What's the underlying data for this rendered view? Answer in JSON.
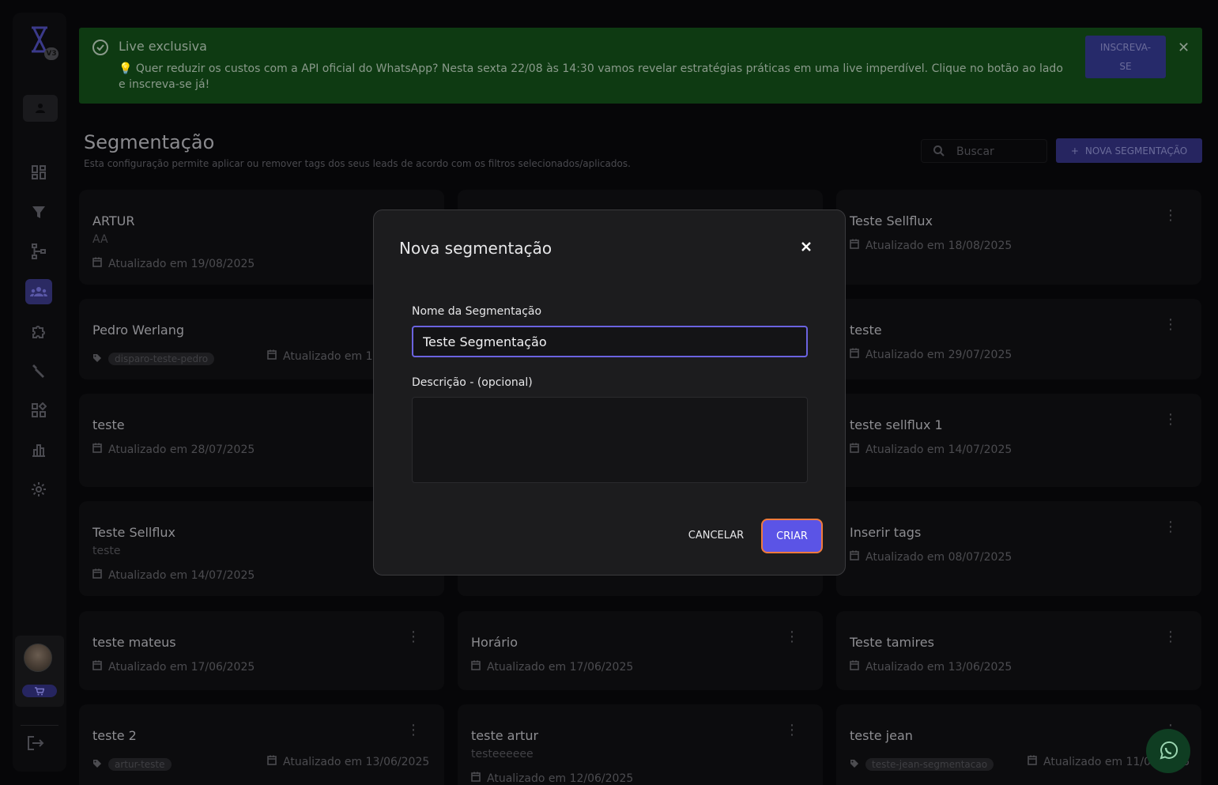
{
  "banner": {
    "title": "Live exclusiva",
    "message": "💡 Quer reduzir os custos com a API oficial do WhatsApp? Nesta sexta 22/08 às 14:30 vamos revelar estratégias práticas em uma live imperdível. Clique no botão ao lado e inscreva-se já!",
    "button_line1": "INSCREVA-",
    "button_line2": "SE",
    "close_label": "✕"
  },
  "sidebar": {
    "version_badge": "V3",
    "items": [
      "dashboard-icon",
      "funnel-icon",
      "flow-icon",
      "segment-icon",
      "integration-icon",
      "tools-icon",
      "apps-icon",
      "reports-icon",
      "settings-icon"
    ],
    "active_item": "segment-icon"
  },
  "page": {
    "title": "Segmentação",
    "subtitle": "Esta configuração permite aplicar ou remover tags dos seus leads de acordo com os filtros selecionados/aplicados.",
    "search_placeholder": "Buscar",
    "new_button": "NOVA SEGMENTAÇÃO"
  },
  "cards": [
    {
      "title": "ARTUR",
      "desc": "AA",
      "date": "Atualizado em 19/08/2025"
    },
    {
      "title": "Teste Sellflux",
      "date": "Atualizado em 18/08/2025"
    },
    {
      "title": "Pedro Werlang",
      "tag": "disparo-teste-pedro",
      "date": "Atualizado em 1"
    },
    {
      "title": "teste",
      "date": "Atualizado em 29/07/2025"
    },
    {
      "title": "teste",
      "date": "Atualizado em 28/07/2025"
    },
    {
      "title": "teste sellflux 1",
      "date": "Atualizado em 14/07/2025"
    },
    {
      "title": "Teste Sellflux",
      "desc": "teste",
      "date": "Atualizado em 14/07/2025"
    },
    {
      "title": "Inserir tags",
      "date": "Atualizado em 08/07/2025"
    },
    {
      "title": "teste mateus",
      "date": "Atualizado em 17/06/2025"
    },
    {
      "title": "Horário",
      "date": "Atualizado em 17/06/2025"
    },
    {
      "title": "Teste tamires",
      "date": "Atualizado em 13/06/2025"
    },
    {
      "title": "teste 2",
      "tag": "artur-teste",
      "date": "Atualizado em 13/06/2025"
    },
    {
      "title": "teste artur",
      "desc": "testeeeeee",
      "date": "Atualizado em 12/06/2025"
    },
    {
      "title": "teste jean",
      "tag": "teste-jean-segmentacao",
      "date": "Atualizado em 11/06/2025"
    }
  ],
  "modal": {
    "title": "Nova segmentação",
    "name_label": "Nome da Segmentação",
    "name_value": "Teste Segmentação",
    "desc_label": "Descrição - (opcional)",
    "desc_value": "",
    "cancel_label": "CANCELAR",
    "create_label": "CRIAR"
  },
  "colors": {
    "accent": "#5b54e6",
    "focus_ring": "#f07a3c",
    "banner_bg": "#0e3a12",
    "background": "#060608"
  }
}
